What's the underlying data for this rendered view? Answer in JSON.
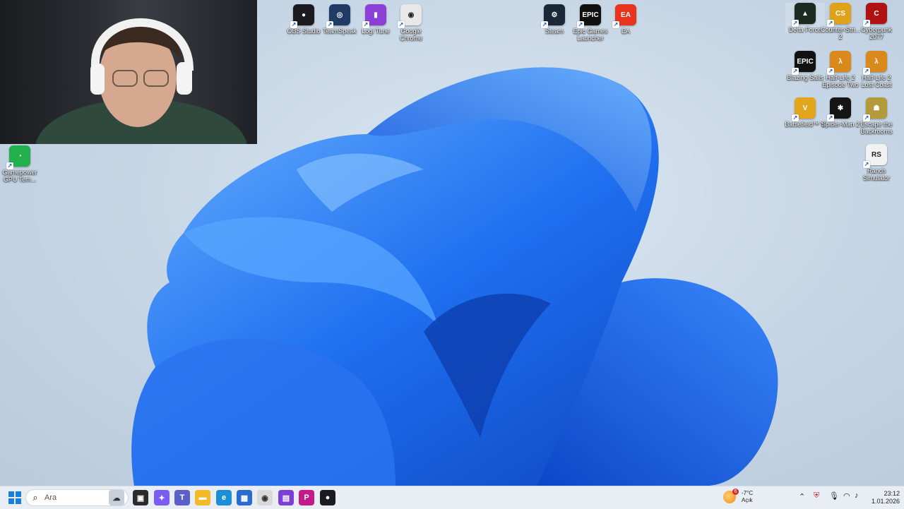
{
  "top_icons": [
    {
      "label": "OBS Studio",
      "icon": "obs-icon",
      "color": "#1b1b1f",
      "glyph": "●"
    },
    {
      "label": "TeamSpeak",
      "icon": "teamspeak-icon",
      "color": "#1f3b66",
      "glyph": "◎"
    },
    {
      "label": "Logi Tune",
      "icon": "logi-tune-icon",
      "color": "#8b3fd6",
      "glyph": "▮"
    },
    {
      "label": "Google Chrome",
      "icon": "chrome-icon",
      "color": "#e8e8e8",
      "glyph": "◉"
    },
    {
      "label": "Steam",
      "icon": "steam-icon",
      "color": "#1b2838",
      "glyph": "⚙"
    },
    {
      "label": "Epic Games Launcher",
      "icon": "epic-games-icon",
      "color": "#111111",
      "glyph": "EPIC"
    },
    {
      "label": "EA",
      "icon": "ea-icon",
      "color": "#e8341c",
      "glyph": "EA"
    }
  ],
  "right_icons": [
    {
      "label": "Delta Force",
      "icon": "delta-force-icon",
      "color": "#1d2a22",
      "glyph": "▲"
    },
    {
      "label": "Counter-Stri... 2",
      "icon": "counter-strike-icon",
      "color": "#e0a21a",
      "glyph": "CS"
    },
    {
      "label": "Cyberpunk 2077",
      "icon": "cyberpunk-icon",
      "color": "#b01212",
      "glyph": "C"
    },
    {
      "label": "Blazing Sails",
      "icon": "blazing-sails-icon",
      "color": "#121212",
      "glyph": "EPIC"
    },
    {
      "label": "Half-Life 2 Episode Two",
      "icon": "half-life-icon",
      "color": "#d98a1a",
      "glyph": "λ"
    },
    {
      "label": "Half-Life 2 Lost Coast",
      "icon": "half-life-lost-coast-icon",
      "color": "#d98a1a",
      "glyph": "λ"
    },
    {
      "label": "Battlefield™ V",
      "icon": "battlefield-icon",
      "color": "#e3a51c",
      "glyph": "V"
    },
    {
      "label": "Spider-Man 2",
      "icon": "spider-man-icon",
      "color": "#151515",
      "glyph": "✱"
    },
    {
      "label": "Escape the Backrooms",
      "icon": "escape-backrooms-icon",
      "color": "#b49a3a",
      "glyph": "☗"
    },
    {
      "label": "Ranch Simulator",
      "icon": "ranch-simulator-icon",
      "color": "#f2f2f2",
      "glyph": "RS"
    }
  ],
  "left_icon": {
    "label": "Gamepower GPU Tem...",
    "icon": "gamepower-icon",
    "color": "#21b04b",
    "glyph": "◔"
  },
  "taskbar": {
    "search_placeholder": "Ara",
    "apps": [
      {
        "name": "widgets-icon",
        "color": "#c8cfd8",
        "glyph": "☁"
      },
      {
        "name": "task-view-icon",
        "color": "#2b2b2b",
        "glyph": "▣"
      },
      {
        "name": "copilot-icon",
        "color": "#7b5cf0",
        "glyph": "✦"
      },
      {
        "name": "teams-icon",
        "color": "#5b5fc7",
        "glyph": "T"
      },
      {
        "name": "file-explorer-icon",
        "color": "#f2b928",
        "glyph": "▬"
      },
      {
        "name": "edge-icon",
        "color": "#1a8fd6",
        "glyph": "e"
      },
      {
        "name": "store-icon",
        "color": "#2a6bd1",
        "glyph": "▦"
      },
      {
        "name": "chrome-taskbar-icon",
        "color": "#d9d9d9",
        "glyph": "◉"
      },
      {
        "name": "clapper-app-icon",
        "color": "#7b3fd6",
        "glyph": "▤"
      },
      {
        "name": "p-app-icon",
        "color": "#c21a8a",
        "glyph": "P"
      },
      {
        "name": "obs-taskbar-icon",
        "color": "#1b1b1f",
        "glyph": "●"
      }
    ],
    "weather": {
      "temp": "-7°C",
      "condition": "Açık",
      "badge": "6"
    },
    "clock": {
      "time": "23:12",
      "date": "1.01.2026"
    }
  }
}
